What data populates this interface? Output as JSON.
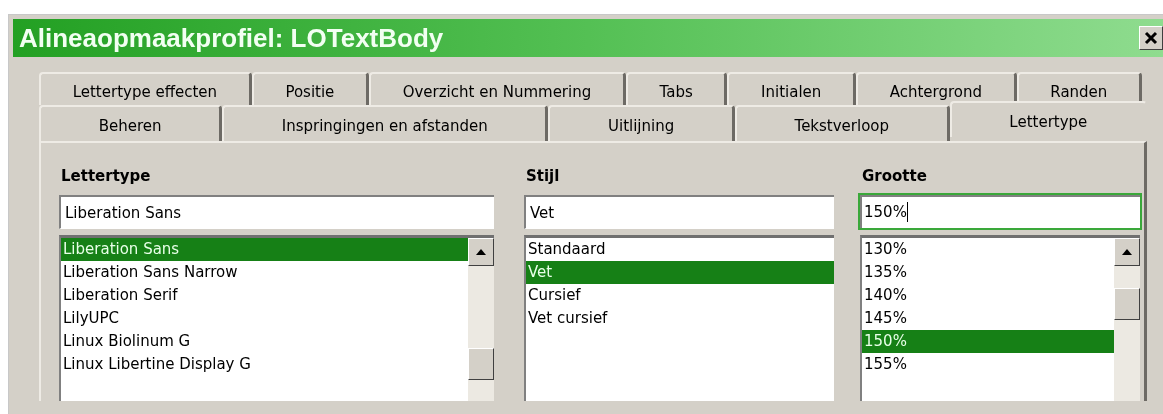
{
  "window": {
    "title": "Alineaopmaakprofiel: LOTextBody"
  },
  "tab_rows": [
    [
      {
        "label": "Lettertype effecten",
        "selected": false
      },
      {
        "label": "Positie",
        "selected": false
      },
      {
        "label": "Overzicht en Nummering",
        "selected": false
      },
      {
        "label": "Tabs",
        "selected": false
      },
      {
        "label": "Initialen",
        "selected": false
      },
      {
        "label": "Achtergrond",
        "selected": false
      },
      {
        "label": "Randen",
        "selected": false
      }
    ],
    [
      {
        "label": "Beheren",
        "selected": false
      },
      {
        "label": "Inspringingen en afstanden",
        "selected": false
      },
      {
        "label": "Uitlijning",
        "selected": false
      },
      {
        "label": "Tekstverloop",
        "selected": false
      },
      {
        "label": "Lettertype",
        "selected": true
      }
    ]
  ],
  "columns": [
    {
      "heading": "Lettertype",
      "field": {
        "value": "Liberation Sans",
        "focused": false
      },
      "scrollbar": true,
      "items": [
        {
          "label": "Liberation Sans",
          "selected": true
        },
        {
          "label": "Liberation Sans Narrow",
          "selected": false
        },
        {
          "label": "Liberation Serif",
          "selected": false
        },
        {
          "label": "LilyUPC",
          "selected": false
        },
        {
          "label": "Linux Biolinum G",
          "selected": false
        },
        {
          "label": "Linux Libertine Display G",
          "selected": false
        }
      ]
    },
    {
      "heading": "Stijl",
      "field": {
        "value": "Vet",
        "focused": false
      },
      "scrollbar": false,
      "items": [
        {
          "label": "Standaard",
          "selected": false
        },
        {
          "label": "Vet",
          "selected": true
        },
        {
          "label": "Cursief",
          "selected": false
        },
        {
          "label": "Vet cursief",
          "selected": false
        }
      ]
    },
    {
      "heading": "Grootte",
      "field": {
        "value": "150%",
        "focused": true
      },
      "scrollbar": true,
      "items": [
        {
          "label": "130%",
          "selected": false
        },
        {
          "label": "135%",
          "selected": false
        },
        {
          "label": "140%",
          "selected": false
        },
        {
          "label": "145%",
          "selected": false
        },
        {
          "label": "150%",
          "selected": true
        },
        {
          "label": "155%",
          "selected": false
        }
      ]
    }
  ]
}
